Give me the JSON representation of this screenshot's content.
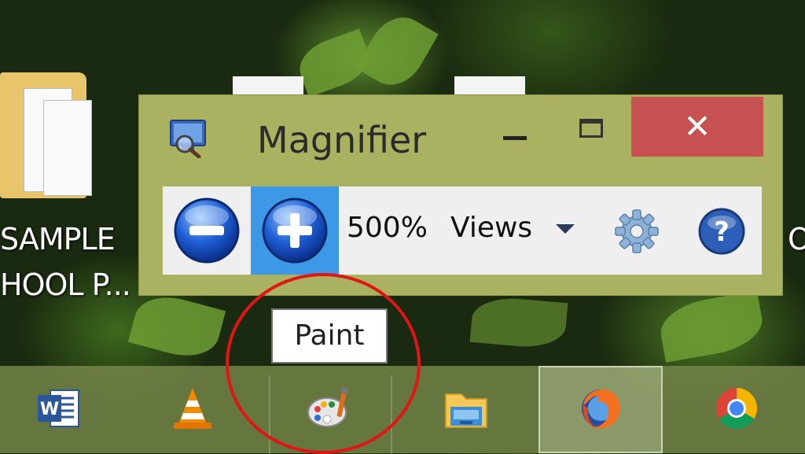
{
  "desktop": {
    "icons": [
      {
        "label_line1": "SAMPLE",
        "label_line2": "HOOL P..."
      },
      {
        "label_line1": "O"
      }
    ]
  },
  "magnifier": {
    "title": "Magnifier",
    "close_glyph": "✕",
    "zoom_level": "500%",
    "views_label": "Views",
    "icons": [
      "magnifier-app-icon",
      "zoom-out-icon",
      "zoom-in-icon",
      "gear-icon",
      "help-icon"
    ]
  },
  "tooltip": {
    "text": "Paint"
  },
  "taskbar": {
    "apps": [
      {
        "name": "word-icon",
        "glyph": "W"
      },
      {
        "name": "vlc-icon"
      },
      {
        "name": "paint-icon"
      },
      {
        "name": "file-explorer-icon"
      },
      {
        "name": "firefox-icon",
        "active": true
      },
      {
        "name": "chrome-icon"
      }
    ]
  },
  "colors": {
    "window_frame": "#aab261",
    "close_button": "#c75050",
    "zoom_in_active": "#3d99e6",
    "annotation_circle": "#e01515"
  }
}
